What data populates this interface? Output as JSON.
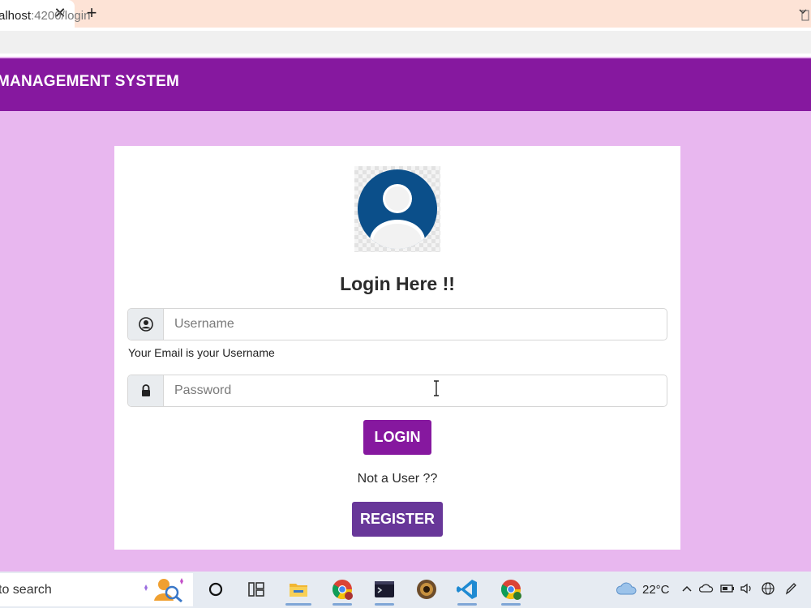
{
  "browser": {
    "close_tab_glyph": "✕",
    "new_tab_glyph": "+",
    "url_prefix": "alhost",
    "url_rest": ":4200/login"
  },
  "header": {
    "title": "MANAGEMENT SYSTEM"
  },
  "login": {
    "title": "Login Here !!",
    "username_placeholder": "Username",
    "username_help": "Your Email is your Username",
    "password_placeholder": "Password",
    "login_button": "LOGIN",
    "not_user_text": "Not a User ??",
    "register_button": "REGISTER"
  },
  "taskbar": {
    "search_text": "to search",
    "temperature": "22°C",
    "apps": [
      "task-view",
      "widgets",
      "file-explorer",
      "chrome",
      "terminal",
      "app-badge",
      "vscode",
      "chrome-profile"
    ]
  },
  "colors": {
    "primary": "#86189f",
    "register": "#683799",
    "page_background": "#e8b7ef",
    "avatar": "#0b4f8a"
  }
}
